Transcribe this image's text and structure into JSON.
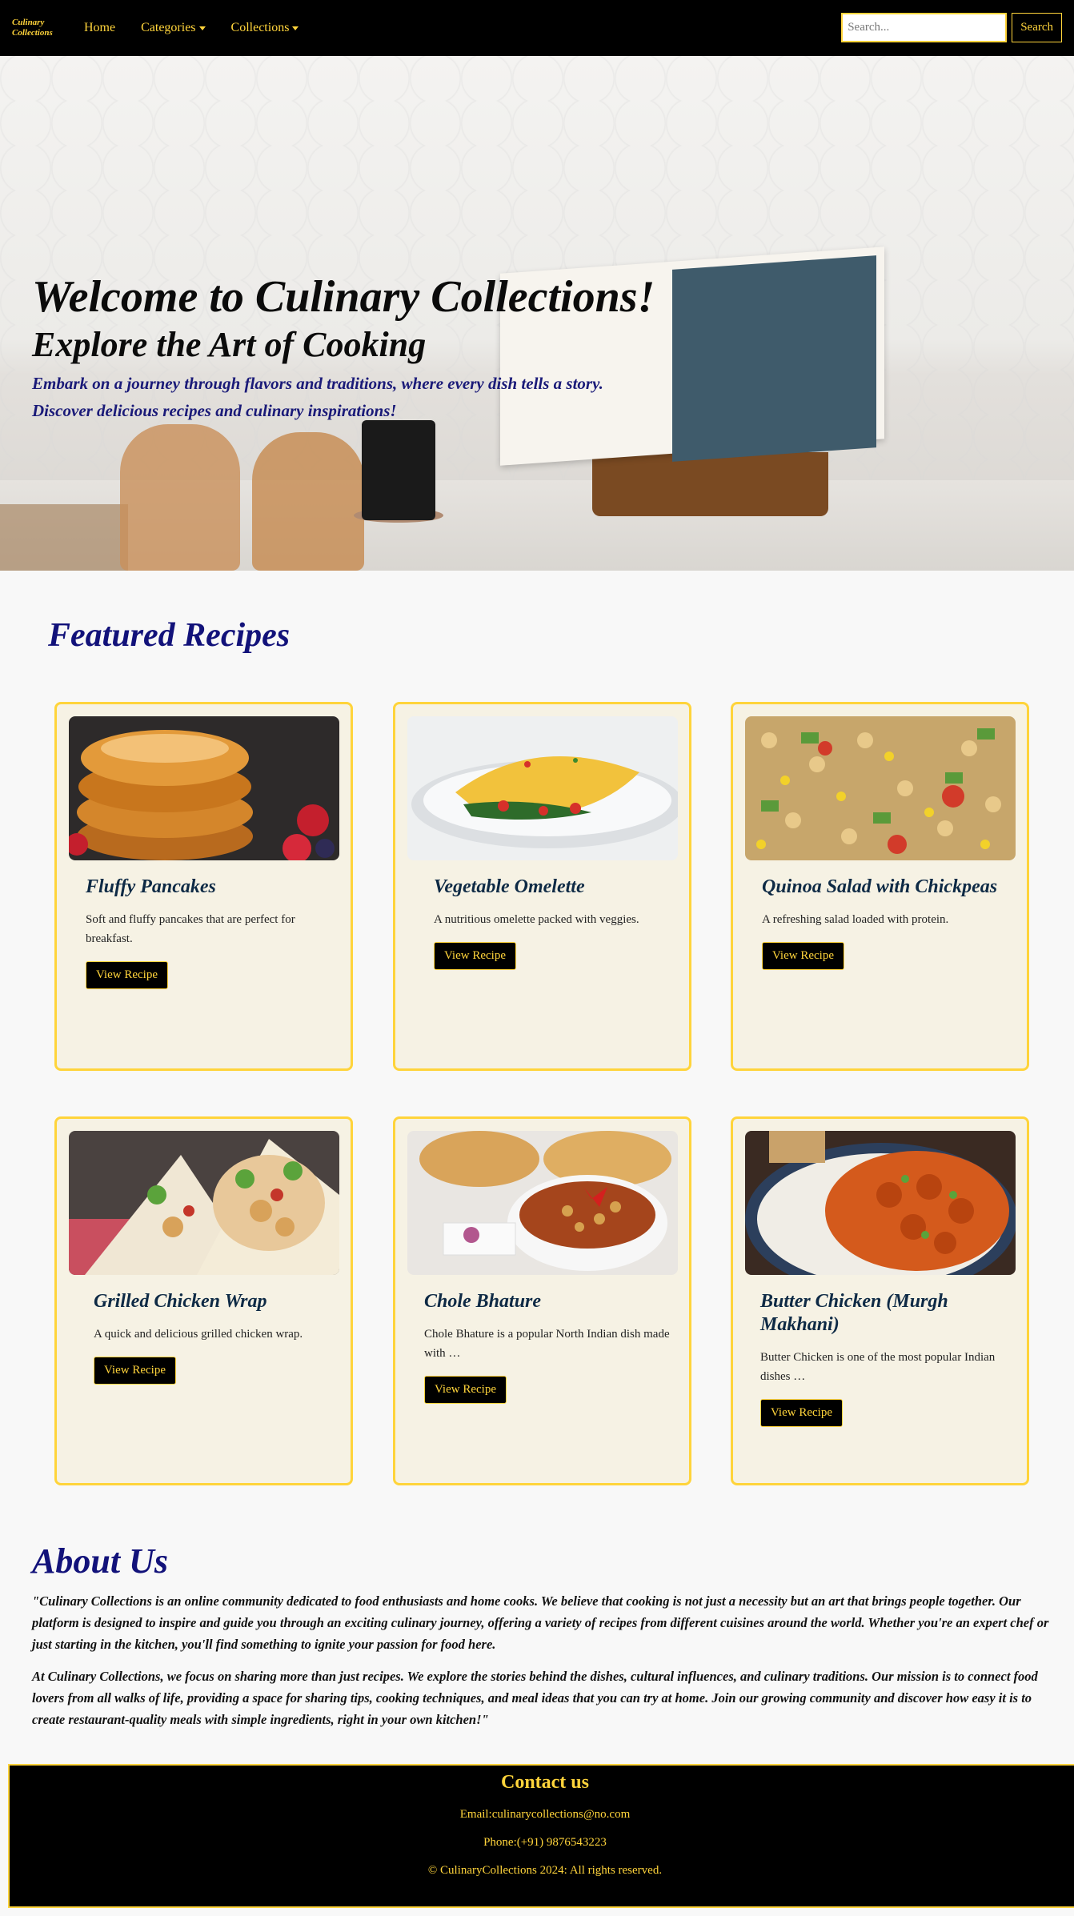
{
  "nav": {
    "brand": "Culinary Collections",
    "links": [
      "Home",
      "Categories",
      "Collections"
    ],
    "search_placeholder": "Search...",
    "search_button": "Search"
  },
  "hero": {
    "title": "Welcome to Culinary Collections!",
    "subtitle": "Explore the Art of Cooking",
    "tagline_1": "Embark on a journey through flavors and traditions, where every dish tells a story.",
    "tagline_2": "Discover delicious recipes and culinary inspirations!"
  },
  "featured": {
    "title": "Featured Recipes",
    "cards": [
      {
        "title": "Fluffy Pancakes",
        "desc": "Soft and fluffy pancakes that are perfect for breakfast.",
        "button": "View Recipe"
      },
      {
        "title": "Vegetable Omelette",
        "desc": "A nutritious omelette packed with veggies.",
        "button": "View Recipe"
      },
      {
        "title": "Quinoa Salad with Chickpeas",
        "desc": "A refreshing salad loaded with protein.",
        "button": "View Recipe"
      },
      {
        "title": "Grilled Chicken Wrap",
        "desc": "A quick and delicious grilled chicken wrap.",
        "button": "View Recipe"
      },
      {
        "title": "Chole Bhature",
        "desc": "Chole Bhature is a popular North Indian dish made with …",
        "button": "View Recipe"
      },
      {
        "title": "Butter Chicken (Murgh Makhani)",
        "desc": "Butter Chicken is one of the most popular Indian dishes …",
        "button": "View Recipe"
      }
    ]
  },
  "about": {
    "title": "About Us",
    "p1": "\"Culinary Collections is an online community dedicated to food enthusiasts and home cooks. We believe that cooking is not just a necessity but an art that brings people together. Our platform is designed to inspire and guide you through an exciting culinary journey, offering a variety of recipes from different cuisines around the world. Whether you're an expert chef or just starting in the kitchen, you'll find something to ignite your passion for food here.",
    "p2": "At Culinary Collections, we focus on sharing more than just recipes. We explore the stories behind the dishes, cultural influences, and culinary traditions. Our mission is to connect food lovers from all walks of life, providing a space for sharing tips, cooking techniques, and meal ideas that you can try at home. Join our growing community and discover how easy it is to create restaurant-quality meals with simple ingredients, right in your own kitchen!\""
  },
  "footer": {
    "title": "Contact us",
    "email": "Email:culinarycollections@no.com",
    "phone": "Phone:(+91) 9876543223",
    "copyright": "© CulinaryCollections 2024: All rights reserved."
  },
  "colors": {
    "accent": "#ffd43b",
    "heading_blue": "#12127a",
    "card_bg": "#f6f2e4"
  }
}
